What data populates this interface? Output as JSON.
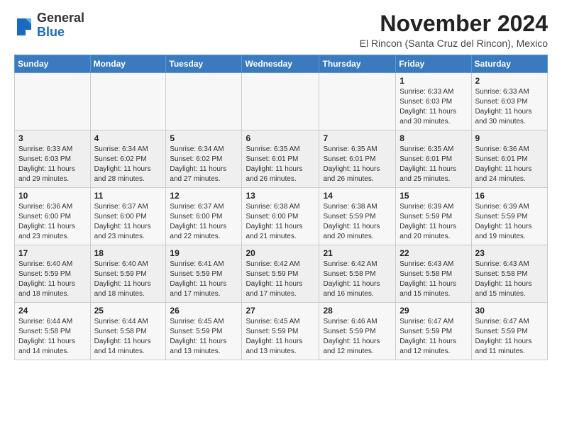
{
  "header": {
    "logo_general": "General",
    "logo_blue": "Blue",
    "month_year": "November 2024",
    "location": "El Rincon (Santa Cruz del Rincon), Mexico"
  },
  "days_of_week": [
    "Sunday",
    "Monday",
    "Tuesday",
    "Wednesday",
    "Thursday",
    "Friday",
    "Saturday"
  ],
  "weeks": [
    [
      {
        "day": "",
        "info": ""
      },
      {
        "day": "",
        "info": ""
      },
      {
        "day": "",
        "info": ""
      },
      {
        "day": "",
        "info": ""
      },
      {
        "day": "",
        "info": ""
      },
      {
        "day": "1",
        "info": "Sunrise: 6:33 AM\nSunset: 6:03 PM\nDaylight: 11 hours and 30 minutes."
      },
      {
        "day": "2",
        "info": "Sunrise: 6:33 AM\nSunset: 6:03 PM\nDaylight: 11 hours and 30 minutes."
      }
    ],
    [
      {
        "day": "3",
        "info": "Sunrise: 6:33 AM\nSunset: 6:03 PM\nDaylight: 11 hours and 29 minutes."
      },
      {
        "day": "4",
        "info": "Sunrise: 6:34 AM\nSunset: 6:02 PM\nDaylight: 11 hours and 28 minutes."
      },
      {
        "day": "5",
        "info": "Sunrise: 6:34 AM\nSunset: 6:02 PM\nDaylight: 11 hours and 27 minutes."
      },
      {
        "day": "6",
        "info": "Sunrise: 6:35 AM\nSunset: 6:01 PM\nDaylight: 11 hours and 26 minutes."
      },
      {
        "day": "7",
        "info": "Sunrise: 6:35 AM\nSunset: 6:01 PM\nDaylight: 11 hours and 26 minutes."
      },
      {
        "day": "8",
        "info": "Sunrise: 6:35 AM\nSunset: 6:01 PM\nDaylight: 11 hours and 25 minutes."
      },
      {
        "day": "9",
        "info": "Sunrise: 6:36 AM\nSunset: 6:01 PM\nDaylight: 11 hours and 24 minutes."
      }
    ],
    [
      {
        "day": "10",
        "info": "Sunrise: 6:36 AM\nSunset: 6:00 PM\nDaylight: 11 hours and 23 minutes."
      },
      {
        "day": "11",
        "info": "Sunrise: 6:37 AM\nSunset: 6:00 PM\nDaylight: 11 hours and 23 minutes."
      },
      {
        "day": "12",
        "info": "Sunrise: 6:37 AM\nSunset: 6:00 PM\nDaylight: 11 hours and 22 minutes."
      },
      {
        "day": "13",
        "info": "Sunrise: 6:38 AM\nSunset: 6:00 PM\nDaylight: 11 hours and 21 minutes."
      },
      {
        "day": "14",
        "info": "Sunrise: 6:38 AM\nSunset: 5:59 PM\nDaylight: 11 hours and 20 minutes."
      },
      {
        "day": "15",
        "info": "Sunrise: 6:39 AM\nSunset: 5:59 PM\nDaylight: 11 hours and 20 minutes."
      },
      {
        "day": "16",
        "info": "Sunrise: 6:39 AM\nSunset: 5:59 PM\nDaylight: 11 hours and 19 minutes."
      }
    ],
    [
      {
        "day": "17",
        "info": "Sunrise: 6:40 AM\nSunset: 5:59 PM\nDaylight: 11 hours and 18 minutes."
      },
      {
        "day": "18",
        "info": "Sunrise: 6:40 AM\nSunset: 5:59 PM\nDaylight: 11 hours and 18 minutes."
      },
      {
        "day": "19",
        "info": "Sunrise: 6:41 AM\nSunset: 5:59 PM\nDaylight: 11 hours and 17 minutes."
      },
      {
        "day": "20",
        "info": "Sunrise: 6:42 AM\nSunset: 5:59 PM\nDaylight: 11 hours and 17 minutes."
      },
      {
        "day": "21",
        "info": "Sunrise: 6:42 AM\nSunset: 5:58 PM\nDaylight: 11 hours and 16 minutes."
      },
      {
        "day": "22",
        "info": "Sunrise: 6:43 AM\nSunset: 5:58 PM\nDaylight: 11 hours and 15 minutes."
      },
      {
        "day": "23",
        "info": "Sunrise: 6:43 AM\nSunset: 5:58 PM\nDaylight: 11 hours and 15 minutes."
      }
    ],
    [
      {
        "day": "24",
        "info": "Sunrise: 6:44 AM\nSunset: 5:58 PM\nDaylight: 11 hours and 14 minutes."
      },
      {
        "day": "25",
        "info": "Sunrise: 6:44 AM\nSunset: 5:58 PM\nDaylight: 11 hours and 14 minutes."
      },
      {
        "day": "26",
        "info": "Sunrise: 6:45 AM\nSunset: 5:59 PM\nDaylight: 11 hours and 13 minutes."
      },
      {
        "day": "27",
        "info": "Sunrise: 6:45 AM\nSunset: 5:59 PM\nDaylight: 11 hours and 13 minutes."
      },
      {
        "day": "28",
        "info": "Sunrise: 6:46 AM\nSunset: 5:59 PM\nDaylight: 11 hours and 12 minutes."
      },
      {
        "day": "29",
        "info": "Sunrise: 6:47 AM\nSunset: 5:59 PM\nDaylight: 11 hours and 12 minutes."
      },
      {
        "day": "30",
        "info": "Sunrise: 6:47 AM\nSunset: 5:59 PM\nDaylight: 11 hours and 11 minutes."
      }
    ]
  ]
}
